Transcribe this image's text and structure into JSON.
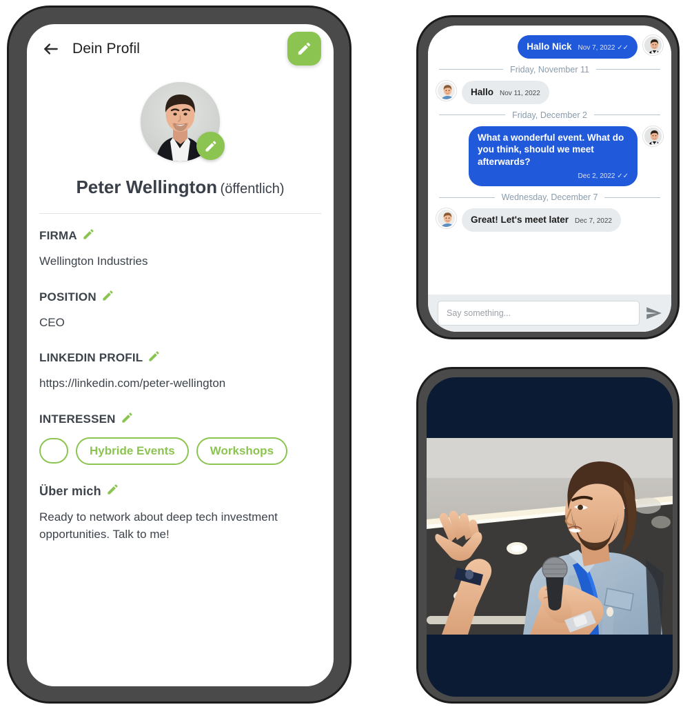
{
  "profile": {
    "header": {
      "back_icon": "back-arrow-icon",
      "title": "Dein Profil",
      "edit_icon": "pencil-icon"
    },
    "avatar": {
      "name": "avatar",
      "edit_icon": "pencil-icon"
    },
    "name": "Peter Wellington",
    "visibility": "(öffentlich)",
    "fields": [
      {
        "label": "FIRMA",
        "value": "Wellington Industries"
      },
      {
        "label": "POSITION",
        "value": "CEO"
      },
      {
        "label": "LINKEDIN PROFIL",
        "value": "https://linkedin.com/peter-wellington"
      }
    ],
    "interests": {
      "label": "INTERESSEN",
      "chips": [
        "",
        "Hybride Events",
        "Workshops"
      ]
    },
    "about": {
      "label": "Über mich",
      "text": "Ready to network about deep tech investment opportunities. Talk to me!"
    }
  },
  "chat": {
    "messages": [
      {
        "dir": "out",
        "text": "Hallo Nick",
        "meta": "Nov 7, 2022 ✓✓",
        "multiline": false
      },
      {
        "divider": "Friday, November 11"
      },
      {
        "dir": "in",
        "text": "Hallo",
        "meta": "Nov 11, 2022",
        "multiline": false
      },
      {
        "divider": "Friday, December 2"
      },
      {
        "dir": "out",
        "text": "What a wonderful event. What do you think, should we meet afterwards?",
        "meta": "Dec 2, 2022 ✓✓",
        "multiline": true
      },
      {
        "divider": "Wednesday, December 7"
      },
      {
        "dir": "in",
        "text": "Great! Let's meet later",
        "meta": "Dec 7, 2022",
        "multiline": false
      }
    ],
    "input": {
      "placeholder": "Say something...",
      "value": "",
      "send_icon": "send-icon"
    }
  },
  "video": {
    "background_color": "#0b1b33",
    "photo_alt": "speaker-with-microphone"
  },
  "colors": {
    "accent_green": "#8CC451",
    "bubble_blue": "#2159DB",
    "bubble_gray": "#e8ebed",
    "navy": "#0b1b33",
    "frame_gray": "#4a4a4a",
    "frame_black": "#1c1c1c"
  }
}
